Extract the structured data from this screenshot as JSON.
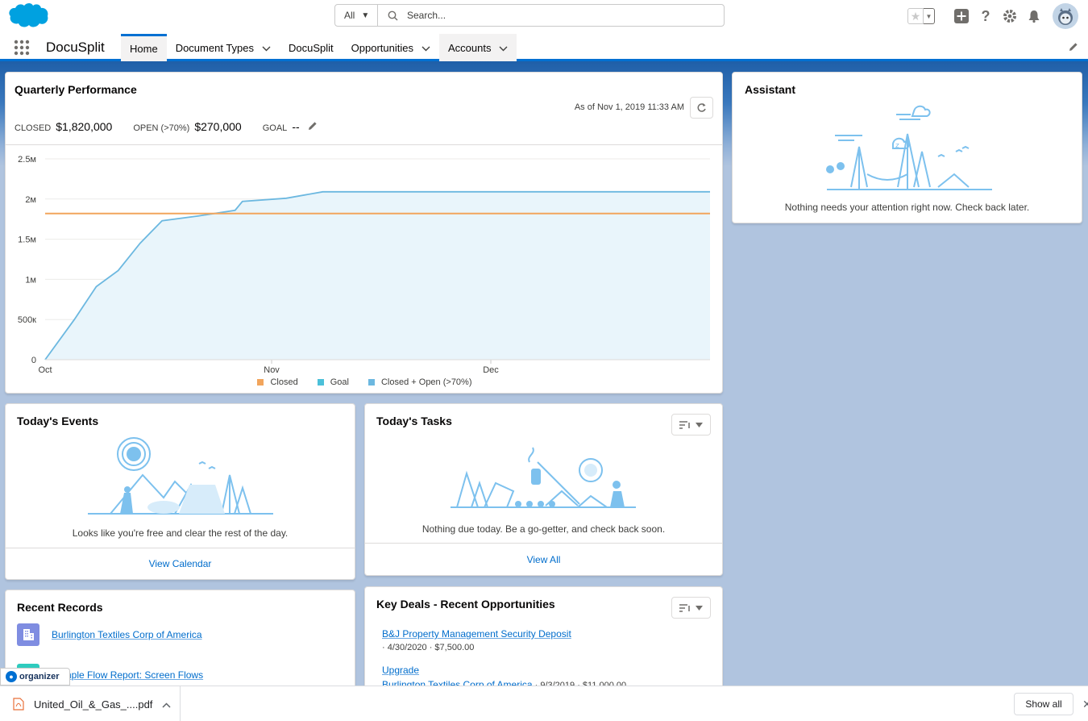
{
  "header": {
    "search_scope": "All",
    "search_placeholder": "Search..."
  },
  "nav": {
    "app_name": "DocuSplit",
    "tabs": [
      {
        "label": "Home",
        "active": true,
        "dropdown": false
      },
      {
        "label": "Document Types",
        "dropdown": true
      },
      {
        "label": "DocuSplit",
        "dropdown": false
      },
      {
        "label": "Opportunities",
        "dropdown": true
      },
      {
        "label": "Accounts",
        "dropdown": true
      }
    ]
  },
  "quarterly": {
    "title": "Quarterly Performance",
    "as_of": "As of Nov 1, 2019 11:33 AM",
    "closed_label": "CLOSED",
    "closed_value": "$1,820,000",
    "open_label": "OPEN (>70%)",
    "open_value": "$270,000",
    "goal_label": "GOAL",
    "goal_value": "--"
  },
  "chart_data": {
    "type": "area",
    "x_ticks": [
      "Oct",
      "Nov",
      "Dec"
    ],
    "y_ticks": [
      "0",
      "500к",
      "1м",
      "1.5м",
      "2м",
      "2.5м"
    ],
    "ylim": [
      0,
      2500000
    ],
    "xlim": [
      "2019-10-01",
      "2019-12-31"
    ],
    "grid": true,
    "legend_position": "bottom",
    "series": [
      {
        "name": "Closed",
        "color": "#f2a55c",
        "type": "line",
        "points": [
          [
            "2019-10-01",
            1820000
          ],
          [
            "2019-12-31",
            1820000
          ]
        ]
      },
      {
        "name": "Goal",
        "color": "#4bc0d9",
        "type": "none",
        "points": []
      },
      {
        "name": "Closed + Open (>70%)",
        "color": "#6cb8e0",
        "type": "area",
        "points": [
          [
            "2019-10-01",
            0
          ],
          [
            "2019-10-05",
            500000
          ],
          [
            "2019-10-08",
            910000
          ],
          [
            "2019-10-11",
            1110000
          ],
          [
            "2019-10-14",
            1450000
          ],
          [
            "2019-10-17",
            1730000
          ],
          [
            "2019-10-22",
            1790000
          ],
          [
            "2019-10-27",
            1860000
          ],
          [
            "2019-10-28",
            1970000
          ],
          [
            "2019-11-03",
            2010000
          ],
          [
            "2019-11-08",
            2090000
          ],
          [
            "2019-12-31",
            2090000
          ]
        ]
      }
    ]
  },
  "assistant": {
    "title": "Assistant",
    "message": "Nothing needs your attention right now. Check back later."
  },
  "events": {
    "title": "Today's Events",
    "message": "Looks like you're free and clear the rest of the day.",
    "footer_link": "View Calendar"
  },
  "tasks": {
    "title": "Today's Tasks",
    "message": "Nothing due today. Be a go-getter, and check back soon.",
    "footer_link": "View All"
  },
  "recent": {
    "title": "Recent Records",
    "items": [
      {
        "label": "Burlington Textiles Corp of America",
        "icon": "building-icon",
        "color": "#7f8de1"
      },
      {
        "label": "Sample Flow Report: Screen Flows",
        "icon": "report-icon",
        "color": "#2ecbbe"
      }
    ]
  },
  "deals": {
    "title": "Key Deals - Recent Opportunities",
    "items": [
      {
        "name": "B&J Property Management Security Deposit",
        "meta": "· 4/30/2020 · $7,500.00"
      },
      {
        "name": "Upgrade",
        "account": "Burlington Textiles Corp of America",
        "meta": " · 9/3/2019 · $11,000.00"
      }
    ]
  },
  "organizer": {
    "label": "organizer"
  },
  "downloads": {
    "file_name": "United_Oil_&_Gas_....pdf",
    "show_all": "Show all"
  }
}
